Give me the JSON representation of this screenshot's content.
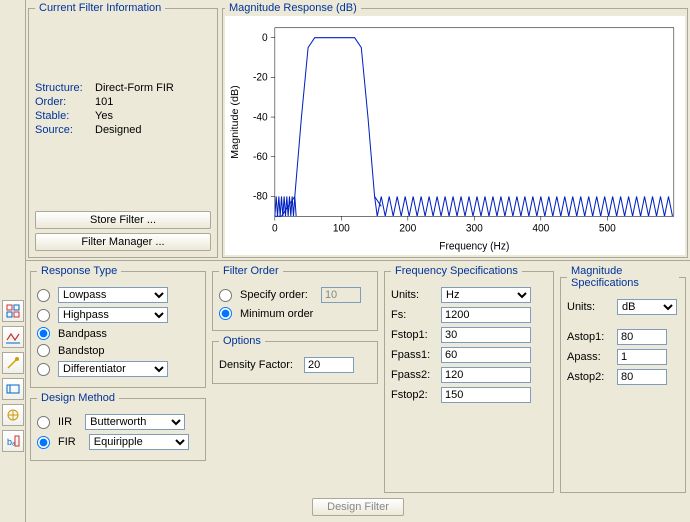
{
  "filter_info": {
    "legend": "Current Filter Information",
    "structure_label": "Structure:",
    "structure": "Direct-Form FIR",
    "order_label": "Order:",
    "order": "101",
    "stable_label": "Stable:",
    "stable": "Yes",
    "source_label": "Source:",
    "source": "Designed",
    "store_btn": "Store Filter ...",
    "manager_btn": "Filter Manager ..."
  },
  "chart": {
    "legend": "Magnitude Response (dB)",
    "xlabel": "Frequency (Hz)",
    "ylabel": "Magnitude (dB)"
  },
  "response_type": {
    "legend": "Response Type",
    "lowpass": "Lowpass",
    "highpass": "Highpass",
    "bandpass": "Bandpass",
    "bandstop": "Bandstop",
    "differentiator": "Differentiator"
  },
  "design_method": {
    "legend": "Design Method",
    "iir": "IIR",
    "iir_sel": "Butterworth",
    "fir": "FIR",
    "fir_sel": "Equiripple"
  },
  "filter_order": {
    "legend": "Filter Order",
    "specify": "Specify order:",
    "specify_val": "10",
    "minimum": "Minimum order"
  },
  "options": {
    "legend": "Options",
    "density_label": "Density Factor:",
    "density_val": "20"
  },
  "freq_spec": {
    "legend": "Frequency Specifications",
    "units_label": "Units:",
    "units": "Hz",
    "fs_label": "Fs:",
    "fs": "1200",
    "fstop1_label": "Fstop1:",
    "fstop1": "30",
    "fpass1_label": "Fpass1:",
    "fpass1": "60",
    "fpass2_label": "Fpass2:",
    "fpass2": "120",
    "fstop2_label": "Fstop2:",
    "fstop2": "150"
  },
  "mag_spec": {
    "legend": "Magnitude Specifications",
    "units_label": "Units:",
    "units": "dB",
    "astop1_label": "Astop1:",
    "astop1": "80",
    "apass_label": "Apass:",
    "apass": "1",
    "astop2_label": "Astop2:",
    "astop2": "80"
  },
  "design_filter_btn": "Design Filter",
  "chart_data": {
    "type": "line",
    "title": "Magnitude Response (dB)",
    "xlabel": "Frequency (Hz)",
    "ylabel": "Magnitude (dB)",
    "xlim": [
      0,
      600
    ],
    "ylim": [
      -90,
      5
    ],
    "xticks": [
      0,
      100,
      200,
      300,
      400,
      500
    ],
    "yticks": [
      0,
      -20,
      -40,
      -60,
      -80
    ],
    "series": [
      {
        "name": "Magnitude",
        "x": [
          0,
          10,
          20,
          30,
          40,
          50,
          60,
          80,
          100,
          120,
          130,
          140,
          150,
          160,
          600
        ],
        "y": [
          -90,
          -90,
          -85,
          -80,
          -40,
          -5,
          0,
          0,
          0,
          0,
          -5,
          -40,
          -80,
          -85,
          -85
        ]
      }
    ],
    "note": "Stopband has ripple oscillating between approximately -80 dB and -90 dB across 150–600 Hz."
  }
}
